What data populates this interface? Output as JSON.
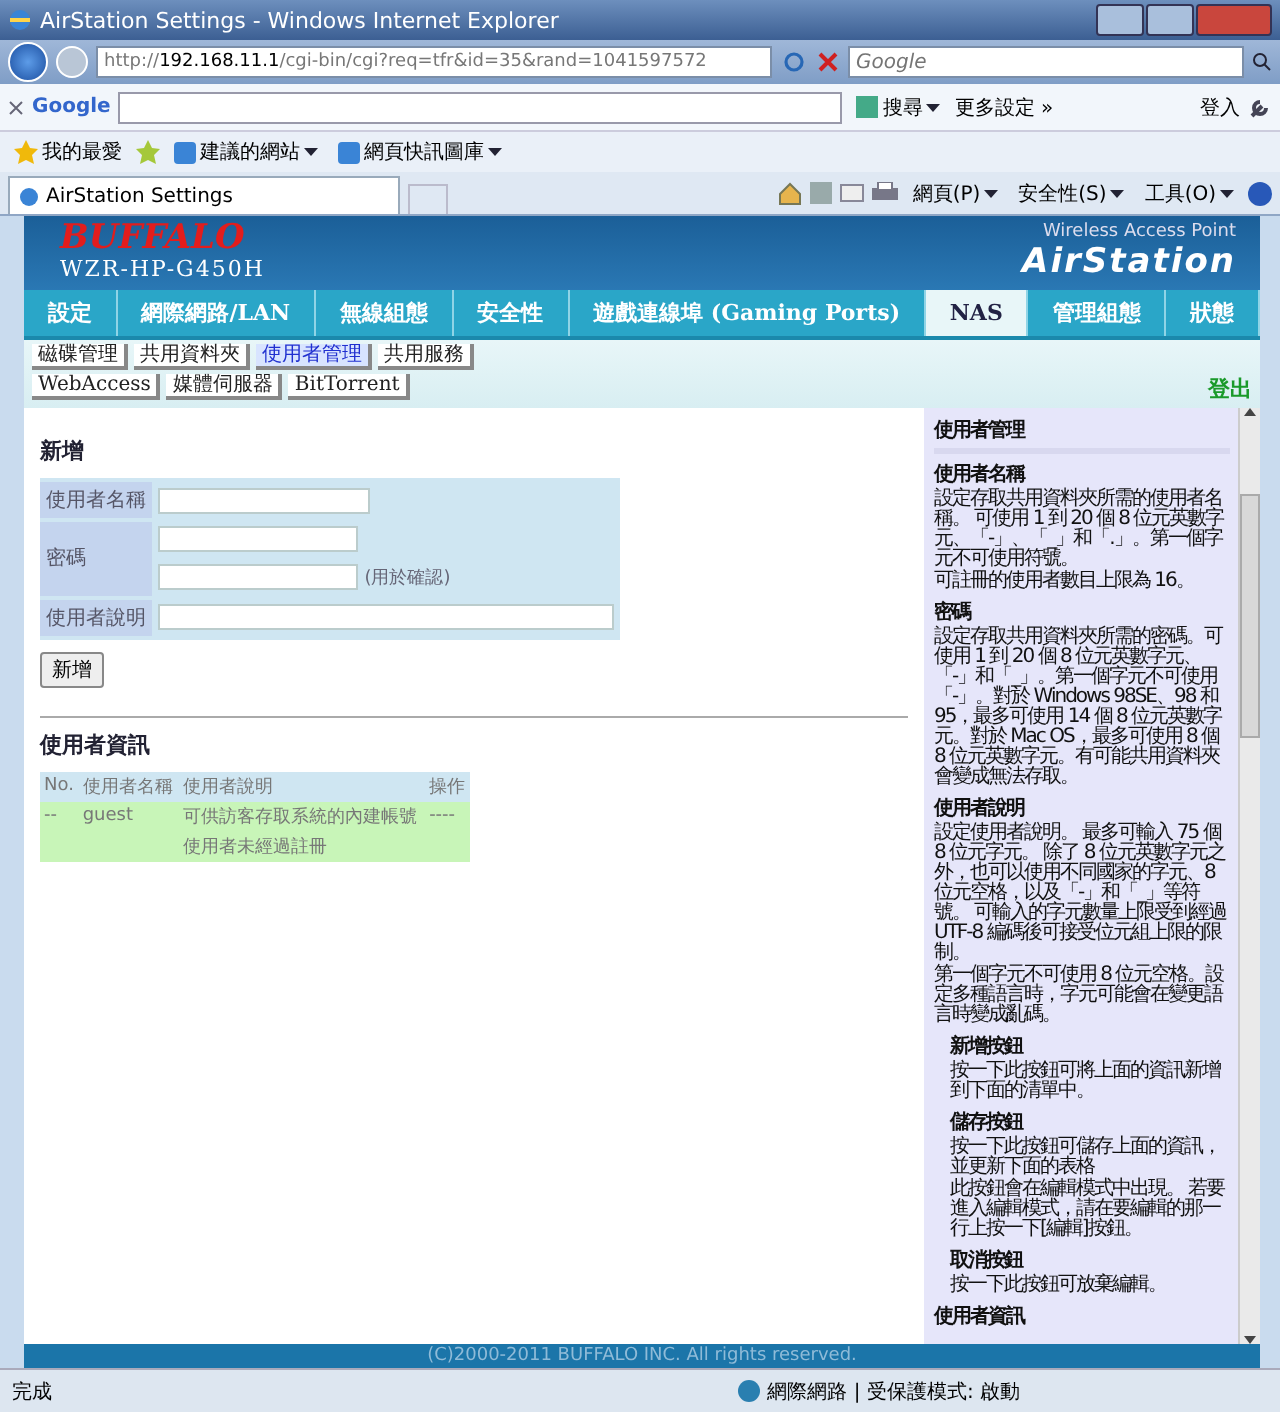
{
  "browser": {
    "title": "AirStation Settings - Windows Internet Explorer",
    "url": "http://192.168.11.1/cgi-bin/cgi?req=tfr&id=35&rand=1041597572",
    "search_placeholder": "Google",
    "google_bar": {
      "logo": "Google",
      "search_button": "搜尋",
      "more": "更多設定 »",
      "signin": "登入"
    },
    "favorites": {
      "label": "我的最愛",
      "links": [
        "建議的網站",
        "網頁快訊圖庫"
      ]
    },
    "tab": "AirStation Settings",
    "commands": [
      "網頁(P)",
      "安全性(S)",
      "工具(O)"
    ]
  },
  "header": {
    "brand": "BUFFALO",
    "model": "WZR-HP-G450H",
    "subtitle": "Wireless Access Point",
    "product": "AirStation"
  },
  "nav": [
    {
      "label": "設定",
      "selected": false
    },
    {
      "label": "網際網路/LAN",
      "selected": false
    },
    {
      "label": "無線組態",
      "selected": false
    },
    {
      "label": "安全性",
      "selected": false
    },
    {
      "label": "遊戲連線埠 (Gaming Ports)",
      "selected": false
    },
    {
      "label": "NAS",
      "selected": true
    },
    {
      "label": "管理組態",
      "selected": false
    },
    {
      "label": "狀態",
      "selected": false
    }
  ],
  "subnav_rows": [
    [
      {
        "label": "磁碟管理",
        "selected": false
      },
      {
        "label": "共用資料夾",
        "selected": false
      },
      {
        "label": "使用者管理",
        "selected": true
      },
      {
        "label": "共用服務",
        "selected": false
      }
    ],
    [
      {
        "label": "WebAccess",
        "selected": false
      },
      {
        "label": "媒體伺服器",
        "selected": false
      },
      {
        "label": "BitTorrent",
        "selected": false
      }
    ]
  ],
  "logout": "登出",
  "form": {
    "title": "新增",
    "fields": [
      {
        "label": "使用者名稱",
        "kind": "text"
      },
      {
        "label": "密碼",
        "kind": "password",
        "confirm_note": "(用於確認)"
      },
      {
        "label": "使用者說明",
        "kind": "wide"
      }
    ],
    "add_button": "新增"
  },
  "users": {
    "title": "使用者資訊",
    "columns": [
      "No.",
      "使用者名稱",
      "使用者說明",
      "操作"
    ],
    "rows": [
      [
        "--",
        "guest",
        "可供訪客存取系統的內建帳號",
        "----"
      ]
    ],
    "note": "使用者未經過註冊"
  },
  "help": {
    "title": "使用者管理",
    "sections": [
      {
        "kind": "topic",
        "heading": "使用者名稱",
        "paragraphs": [
          "設定存取共用資料夾所需的使用者名稱。 可使用 1 到 20 個 8 位元英數字元、「-」、「_」和「.」。第一個字元不可使用符號。",
          "可註冊的使用者數目上限為 16。"
        ]
      },
      {
        "kind": "topic",
        "heading": "密碼",
        "paragraphs": [
          "設定存取共用資料夾所需的密碼。可使用 1 到 20 個 8 位元英數字元、「-」和「_」。第一個字元不可使用「-」。對於 Windows 98SE、98 和 95，最多可使用 14 個 8 位元英數字元。對於 Mac OS，最多可使用 8 個 8 位元英數字元。有可能共用資料夾會變成無法存取。"
        ]
      },
      {
        "kind": "topic",
        "heading": "使用者說明",
        "paragraphs": [
          "設定使用者說明。 最多可輸入 75 個 8 位元字元。 除了 8 位元英數字元之外，也可以使用不同國家的字元、8 位元空格，以及「-」和「_」等符號。 可輸入的字元數量上限受到經過 UTF-8 編碼後可接受位元組上限的限制。",
          "第一個字元不可使用 8 位元空格。設定多種語言時，字元可能會在變更語言時變成亂碼。"
        ]
      },
      {
        "kind": "button",
        "heading": "新增按鈕",
        "paragraphs": [
          "按一下此按鈕可將上面的資訊新增到下面的清單中。"
        ]
      },
      {
        "kind": "button",
        "heading": "儲存按鈕",
        "paragraphs": [
          "按一下此按鈕可儲存上面的資訊，並更新下面的表格",
          "此按鈕會在編輯模式中出現。 若要進入編輯模式，請在要編輯的那一行上按一下[編輯]按鈕。"
        ]
      },
      {
        "kind": "button",
        "heading": "取消按鈕",
        "paragraphs": [
          "按一下此按鈕可放棄編輯。"
        ]
      },
      {
        "kind": "topic",
        "heading": "使用者資訊"
      }
    ]
  },
  "footer": "(C)2000-2011 BUFFALO INC. All rights reserved.",
  "status": {
    "text": "完成",
    "zone": "網際網路 | 受保護模式: 啟動"
  }
}
